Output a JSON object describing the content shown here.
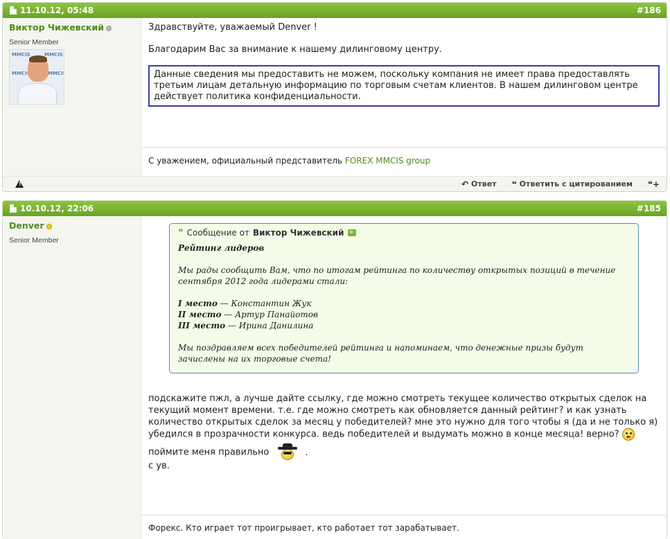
{
  "posts": [
    {
      "date": "11.10.12, 05:48",
      "number": "#186",
      "username": "Виктор Чижевский",
      "usertitle": "Senior Member",
      "avatar_logo": "MMCIS",
      "greeting": "Здравствуйте, уважаемый Denver !",
      "thanks": "Благодарим Вас за внимание к нашему дилинговому центру.",
      "boxed_text": "Данные сведения мы предоставить не можем, поскольку компания не имеет права предоставлять третьим лицам детальную информацию по торговым счетам клиентов. В нашем дилинговом центре действует политика конфиденциальности.",
      "signature_prefix": "С уважением, официальный представитель",
      "signature_link": "FOREX MMCIS group",
      "footer": {
        "reply_label": "Ответ",
        "quote_label": "Ответить с цитированием"
      }
    },
    {
      "date": "10.10.12, 22:06",
      "number": "#185",
      "username": "Denver",
      "usertitle": "Senior Member",
      "quote": {
        "prefix": "Сообщение от",
        "author": "Виктор Чижевский",
        "title": "Рейтинг лидеров",
        "intro": "Мы рады сообщить Вам, что по итогам рейтинга по количеству открытых позиций в течение сентября 2012 года лидерами стали:",
        "place1_label": "I место",
        "place1_name": " — Константин Жук",
        "place2_label": "II место",
        "place2_name": " — Артур Панайотов",
        "place3_label": "III место",
        "place3_name": " — Ирина Данилина",
        "outro": "Мы поздравляем всех победителей рейтинга и напоминаем, что денежные призы будут зачислены на их торговые счета!"
      },
      "message": "подскажите пжл, а лучше дайте ссылку, где можно смотреть текущее количество открытых сделок на текущий момент времени. т.е. где можно смотреть как обновляется данный рейтинг? и как узнать количество открытых сделок за месяц у победителей? мне это нужно для того чтобы я (да и не только я) убедился в прозрачности конкурса. ведь победителей и выдумать можно в конце месяца! верно?",
      "line2": "поймите меня правильно",
      "line2_end": ".",
      "line3": "с ув.",
      "signature": "Форекс. Кто играет тот проигрывает, кто работает тот зарабатывает."
    }
  ]
}
